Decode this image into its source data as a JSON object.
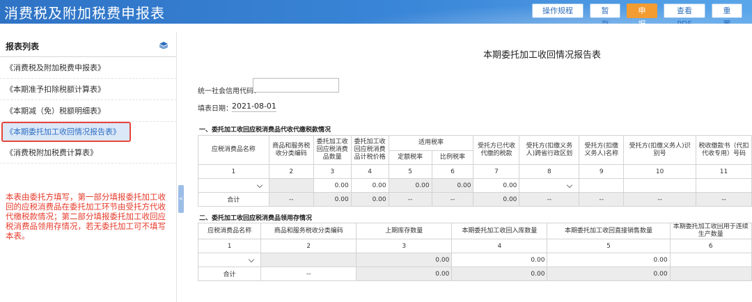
{
  "app": {
    "title": "消费税及附加税费申报表"
  },
  "toolbar": {
    "guide": "操作规程",
    "save": "暂存",
    "submit": "申报",
    "pdf": "查看PDF",
    "reset": "重置"
  },
  "sidebar": {
    "title": "报表列表",
    "items": [
      {
        "label": "《消费税及附加税费申报表》"
      },
      {
        "label": "《本期准予扣除税额计算表》"
      },
      {
        "label": "《本期减（免）税额明细表》"
      },
      {
        "label": "《本期委托加工收回情况报告表》"
      },
      {
        "label": "《消费税附加税费计算表》"
      }
    ],
    "note": "本表由委托方填写，第一部分填报委托加工收回的应税消费品在委托加工环节由受托方代收代缴税款情况；第二部分填报委托加工收回应税消费品领用存情况，若无委托加工可不填写本表。"
  },
  "report": {
    "title": "本期委托加工收回情况报告表",
    "credit_label": "统一社会信用代码：",
    "credit_value": "",
    "date_label": "填表日期：",
    "date_value": "2021-08-01"
  },
  "section1": {
    "label": "一、委托加工收回应税消费品代收代缴税款情况",
    "headers": {
      "c1": "应税消费品名称",
      "c2": "商品和服务税收分类编码",
      "c3": "委托加工收回应税消费品数量",
      "c4": "委托加工收回应税消费品计税价格",
      "rate_group": "适用税率",
      "c5": "定额税率",
      "c6": "比例税率",
      "c7": "受托方已代收代缴的税款",
      "c8": "受托方(扣缴义务人)跨省行政区划",
      "c9": "受托方(扣缴义务人)名称",
      "c10": "受托方(扣缴义务人)识别号",
      "c11": "税收缴款书（代扣代收专用）号码"
    },
    "col_numbers": [
      "1",
      "2",
      "3",
      "4",
      "5",
      "6",
      "7",
      "8",
      "9",
      "10",
      "11"
    ],
    "row": {
      "c3": "0.00",
      "c4": "0.00",
      "c5": "0.00",
      "c6": "0.00",
      "c7": "0.00"
    },
    "total": {
      "label": "合计",
      "c2": "--",
      "c3": "0.00",
      "c4": "0.00",
      "c5": "--",
      "c6": "--",
      "c7": "0.00",
      "c8": "--",
      "c9": "--",
      "c10": "--",
      "c11": "--"
    }
  },
  "section2": {
    "label": "二、委托加工收回应税消费品领用存情况",
    "headers": {
      "c1": "应税消费品名称",
      "c2": "商品和服务税收分类编码",
      "c3": "上期库存数量",
      "c4": "本期委托加工收回入库数量",
      "c5": "本期委托加工收回直接销售数量",
      "c6": "本期委托加工收回用于连续生产数量"
    },
    "col_numbers": [
      "1",
      "2",
      "3",
      "4",
      "5",
      "6"
    ],
    "row": {
      "c3": "0.00",
      "c4": "0.00",
      "c5": "0.00"
    },
    "total": {
      "label": "合计",
      "c2": "--",
      "c3": "0.00",
      "c4": "0.00",
      "c5": "0.00"
    }
  }
}
